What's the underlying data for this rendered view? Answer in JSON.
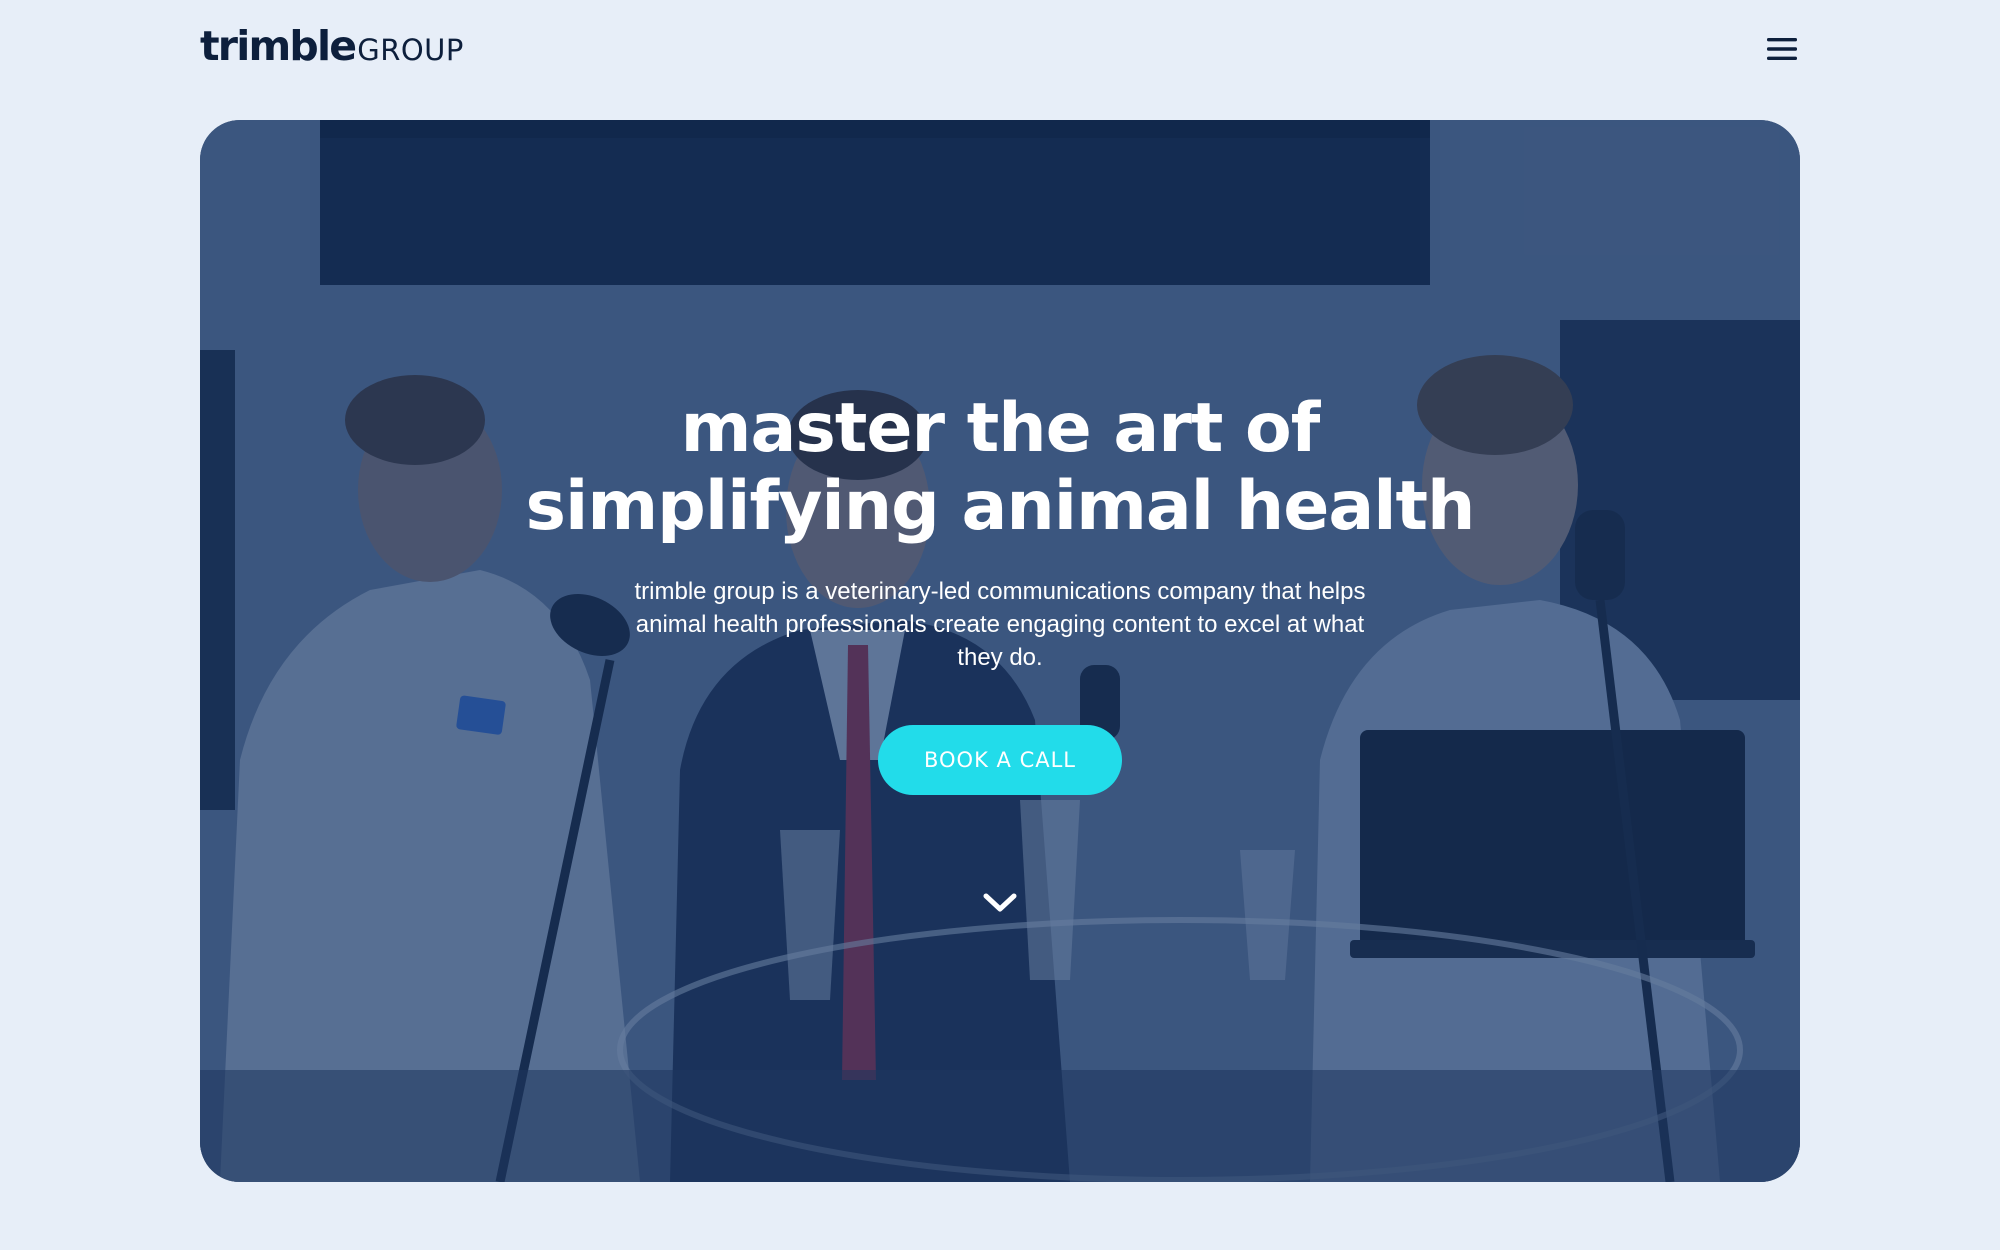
{
  "header": {
    "logo_word": "trimble",
    "logo_group": "GROUP",
    "menu_icon": "hamburger-menu-icon"
  },
  "hero": {
    "title_line1": "master the art of",
    "title_line2": "simplifying animal health",
    "subtitle": "trimble group is a veterinary-led communications company that helps animal health professionals create engaging content to excel at what they do.",
    "cta_label": "BOOK A CALL",
    "scroll_icon": "chevron-down-icon"
  },
  "colors": {
    "page_background": "#e7eef8",
    "brand_navy": "#0d1f3c",
    "hero_overlay": "#143466",
    "cta_background": "#22dcea",
    "text_on_hero": "#ffffff"
  }
}
